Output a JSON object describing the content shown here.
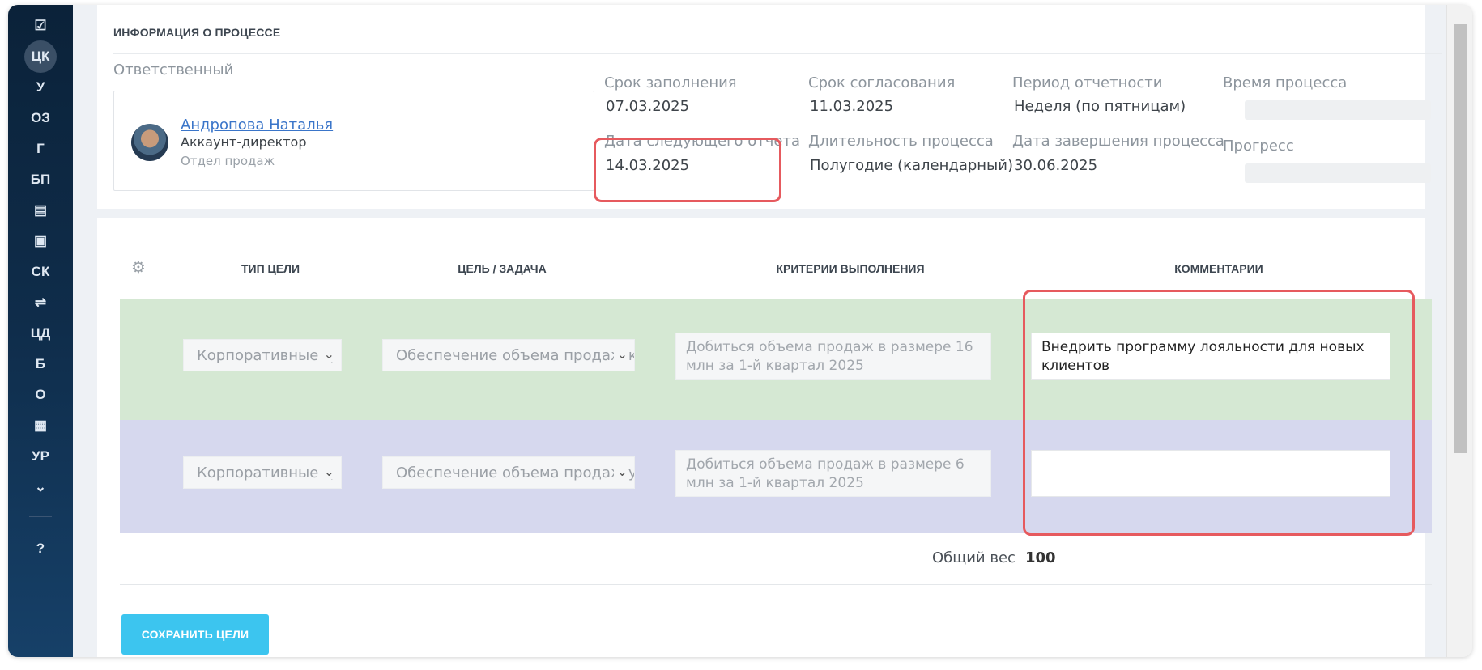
{
  "sidebar": {
    "items": [
      {
        "label": "",
        "icon": "checkbox-icon"
      },
      {
        "label": "ЦК",
        "active": true
      },
      {
        "label": "У"
      },
      {
        "label": "ОЗ"
      },
      {
        "label": "Г"
      },
      {
        "label": "БП"
      },
      {
        "label": "",
        "icon": "calendar-icon"
      },
      {
        "label": "",
        "icon": "id-card-icon"
      },
      {
        "label": "СК"
      },
      {
        "label": "",
        "icon": "sliders-icon"
      },
      {
        "label": "ЦД"
      },
      {
        "label": "Б"
      },
      {
        "label": "О"
      },
      {
        "label": "",
        "icon": "clipboard-list-icon"
      },
      {
        "label": "УР"
      },
      {
        "label": "",
        "icon": "chevron-down-circle-icon"
      },
      {
        "label": "",
        "icon": "help-icon"
      }
    ],
    "glyphs": {
      "checkbox": "☑",
      "calendar": "▤",
      "idcard": "▣",
      "sliders": "⇌",
      "clipboard": "▦",
      "chevron": "⌄",
      "help": "?"
    }
  },
  "process_info": {
    "title": "ИНФОРМАЦИЯ О ПРОЦЕССЕ",
    "responsible_label": "Ответственный",
    "person": {
      "name": "Андропова Наталья",
      "role": "Аккаунт-директор",
      "department": "Отдел продаж"
    },
    "fields": {
      "fill_deadline_label": "Срок заполнения",
      "fill_deadline_value": "07.03.2025",
      "approval_deadline_label": "Срок согласования",
      "approval_deadline_value": "11.03.2025",
      "report_period_label": "Период отчетности",
      "report_period_value": "Неделя (по пятницам)",
      "process_time_label": "Время процесса",
      "next_report_label": "Дата следующего отчета",
      "next_report_value": "14.03.2025",
      "duration_label": "Длительность процесса",
      "duration_value": "Полугодие (календарный)",
      "end_date_label": "Дата завершения процесса",
      "end_date_value": "30.06.2025",
      "progress_label": "Прогресс"
    }
  },
  "goals_table": {
    "headers": {
      "goal_type": "ТИП ЦЕЛИ",
      "goal_task": "ЦЕЛЬ / ЗАДАЧА",
      "criteria": "КРИТЕРИИ ВЫПОЛНЕНИЯ",
      "comments": "КОММЕНТАРИИ"
    },
    "rows": [
      {
        "goal_type": "Корпоративные ц",
        "goal_task": "Обеспечение объема продаж кс",
        "criteria": "Добиться объема продаж в размере 16 млн за 1-й квартал 2025",
        "comment": "Внедрить программу лояльности для новых клиентов",
        "color": "#d5e8d3"
      },
      {
        "goal_type": "Корпоративные ц",
        "goal_task": "Обеспечение объема продаж ус",
        "criteria": "Добиться объема продаж в размере 6 млн за 1-й квартал 2025",
        "comment": "",
        "color": "#d6d8ee"
      }
    ],
    "total_weight_label": "Общий вес",
    "total_weight_value": "100"
  },
  "actions": {
    "save_label": "СОХРАНИТЬ ЦЕЛИ"
  },
  "colors": {
    "accent": "#3cc5ef",
    "highlight": "#e65a5e",
    "sidebar": "#0f2d4b"
  }
}
